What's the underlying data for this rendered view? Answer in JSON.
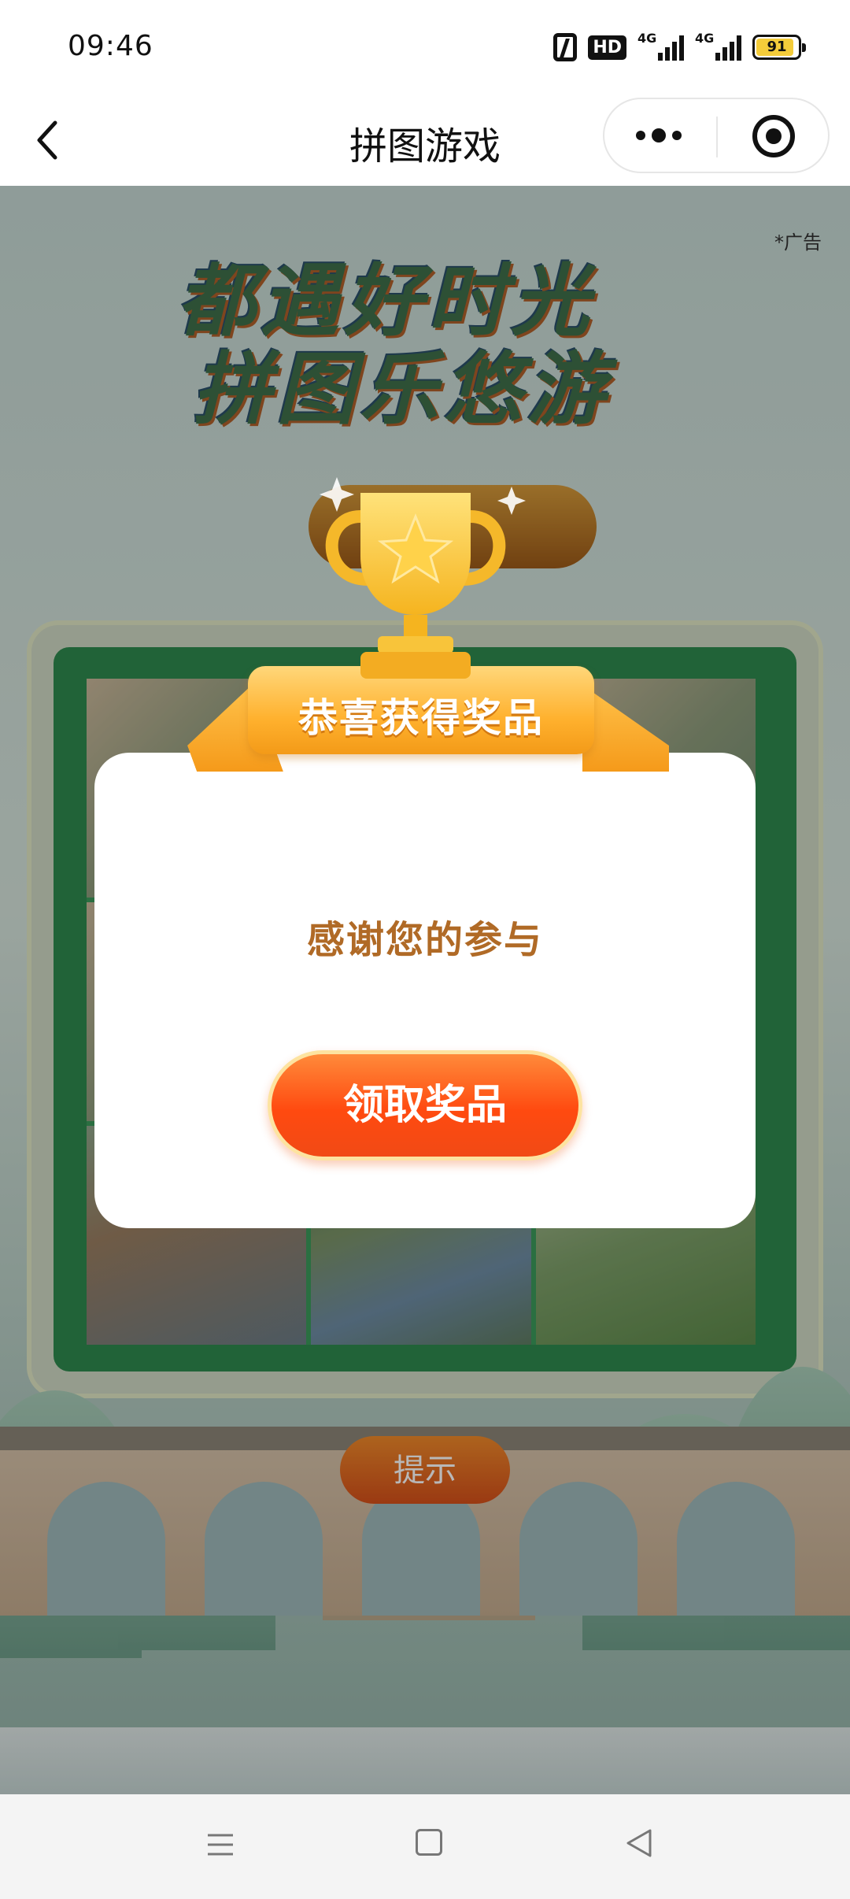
{
  "status_bar": {
    "time": "09:46",
    "icons": [
      "nfc-icon",
      "hd-voice-icon",
      "signal-4g-icon",
      "signal-4g-icon",
      "battery-icon"
    ],
    "network_1": "4G",
    "network_2": "4G",
    "battery_level": "91",
    "hd_label": "HD"
  },
  "nav_bar": {
    "title": "拼图游戏",
    "back_icon": "chevron-left-icon",
    "more_icon": "more-dots-icon",
    "close_icon": "target-icon"
  },
  "game": {
    "ad_tag": "*广告",
    "slogan_line1": "都遇好时光",
    "slogan_line2": "拼图乐悠游",
    "hint_label": "提示",
    "grid_size": "3x3"
  },
  "modal": {
    "ribbon_title": "恭喜获得奖品",
    "message": "感谢您的参与",
    "claim_label": "领取奖品",
    "trophy_icon": "trophy-icon"
  },
  "system_nav": {
    "icons": [
      "menu-icon",
      "home-icon",
      "back-triangle-icon"
    ]
  },
  "colors": {
    "accent_orange": "#ff5a1a",
    "board_green": "#2f8a4e",
    "text_brown": "#b06a26",
    "ribbon_gold": "#ffb12e"
  }
}
